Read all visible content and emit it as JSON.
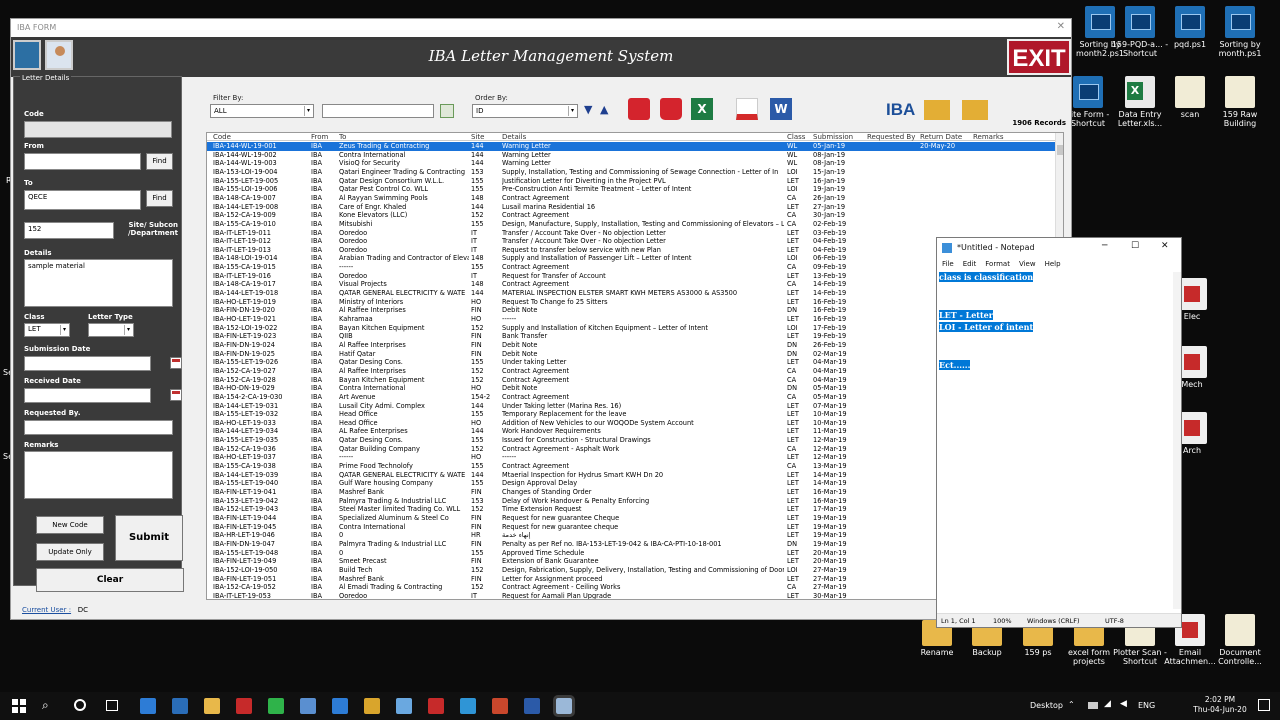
{
  "desktop": {
    "top_icons": [
      {
        "label": "Sorting by month2.ps1",
        "type": "ps"
      },
      {
        "label": "159-PQD-a... - Shortcut",
        "type": "ps"
      },
      {
        "label": "pqd.ps1",
        "type": "ps"
      },
      {
        "label": "Sorting by month.ps1",
        "type": "ps"
      }
    ],
    "mid_icons": [
      {
        "label": "site Form - Shortcut",
        "type": "ps"
      },
      {
        "label": "Data Entry Letter.xls...",
        "type": "xl"
      },
      {
        "label": "scan",
        "type": "doc"
      },
      {
        "label": "159 Raw Building",
        "type": "doc"
      }
    ],
    "side_icons": [
      {
        "label": "Elec",
        "type": "pdfic"
      },
      {
        "label": "Mech",
        "type": "pdfic"
      },
      {
        "label": "Arch",
        "type": "pdfic"
      }
    ],
    "bottom_icons": [
      {
        "label": "Rename",
        "type": "fold"
      },
      {
        "label": "Backup",
        "type": "fold"
      },
      {
        "label": "159 ps",
        "type": "fold"
      },
      {
        "label": "excel form projects",
        "type": "fold"
      },
      {
        "label": "Plotter Scan - Shortcut",
        "type": "doc"
      },
      {
        "label": "Email Attachmen...",
        "type": "pdfic"
      },
      {
        "label": "Document Controlle...",
        "type": "doc"
      }
    ],
    "left_edge_letters": [
      "R",
      "Se",
      "Se"
    ]
  },
  "app": {
    "window_title": "IBA FORM",
    "header_title": "IBA Letter Management System",
    "exit_label": "EXIT",
    "panel_title": "Letter Details",
    "labels": {
      "code": "Code",
      "from": "From",
      "to": "To",
      "site": "Site/ Subcon /Department",
      "details": "Details",
      "class": "Class",
      "letter_type": "Letter Type",
      "submission_date": "Submission Date",
      "received_date": "Received Date",
      "requested_by": "Requested By.",
      "remarks": "Remarks"
    },
    "values": {
      "code": "",
      "from": "",
      "to": "QECE",
      "site": "152",
      "details": "sample material",
      "class": "LET",
      "letter_type": "",
      "submission_date": "",
      "received_date": "",
      "requested_by": "",
      "remarks": ""
    },
    "buttons": {
      "find": "Find",
      "new_code": "New Code",
      "update_only": "Update Only",
      "submit": "Submit",
      "clear": "Clear"
    },
    "current_user_label": "Current User :",
    "current_user": "DC",
    "filter_by_label": "Filter By:",
    "filter_by_value": "ALL",
    "filter_text": "",
    "order_by_label": "Order By:",
    "order_by_value": "ID",
    "brand": "IBA",
    "records": "1906 Records",
    "columns": [
      "Code",
      "From",
      "To",
      "Site",
      "Details",
      "Class",
      "Submission",
      "Requested By",
      "Return Date",
      "Remarks"
    ],
    "rows": [
      [
        "IBA-144-WL-19-001",
        "IBA",
        "Zeus Trading & Contracting",
        "144",
        "Warning Letter",
        "WL",
        "05-Jan-19",
        "",
        "20-May-20",
        ""
      ],
      [
        "IBA-144-WL-19-002",
        "IBA",
        "Contra International",
        "144",
        "Warning Letter",
        "WL",
        "08-Jan-19",
        "",
        "",
        ""
      ],
      [
        "IBA-144-WL-19-003",
        "IBA",
        "VisioQ for Security",
        "144",
        "Warning Letter",
        "WL",
        "08-Jan-19",
        "",
        "",
        ""
      ],
      [
        "IBA-153-LOI-19-004",
        "IBA",
        "Qatari Engineer Trading & Contracting",
        "153",
        "Supply, Installation, Testing and Commissioning of Sewage Connection - Letter of In",
        "LOI",
        "15-Jan-19",
        "",
        "",
        ""
      ],
      [
        "IBA-155-LET-19-005",
        "IBA",
        "Qatar Design Consortium W.L.L.",
        "155",
        "Justification Letter for Diverting in the Project PVL",
        "LET",
        "16-Jan-19",
        "",
        "",
        ""
      ],
      [
        "IBA-155-LOI-19-006",
        "IBA",
        "Qatar Pest Control Co. WLL",
        "155",
        "Pre-Construction Anti Termite Treatment – Letter of Intent",
        "LOI",
        "19-Jan-19",
        "",
        "",
        ""
      ],
      [
        "IBA-148-CA-19-007",
        "IBA",
        "Al Rayyan Swimming Pools",
        "148",
        "Contract Agreement",
        "CA",
        "26-Jan-19",
        "",
        "",
        ""
      ],
      [
        "IBA-144-LET-19-008",
        "IBA",
        "Care  of Engr. Khaled",
        "144",
        "Lusail marina Residential 16",
        "LET",
        "27-Jan-19",
        "",
        "",
        ""
      ],
      [
        "IBA-152-CA-19-009",
        "IBA",
        "Kone Elevators (LLC)",
        "152",
        "Contract Agreement",
        "CA",
        "30-Jan-19",
        "",
        "",
        ""
      ],
      [
        "IBA-155-CA-19-010",
        "IBA",
        "Mitsubishi",
        "155",
        "Design, Manufacture, Supply, Installation, Testing and Commissioning of Elevators – Le",
        "CA",
        "02-Feb-19",
        "",
        "",
        ""
      ],
      [
        "IBA-IT-LET-19-011",
        "IBA",
        "Ooredoo",
        "IT",
        "Transfer / Account Take Over - No objection Letter",
        "LET",
        "03-Feb-19",
        "",
        "",
        ""
      ],
      [
        "IBA-IT-LET-19-012",
        "IBA",
        "Ooredoo",
        "IT",
        "Transfer / Account Take Over - No objection Letter",
        "LET",
        "04-Feb-19",
        "",
        "",
        ""
      ],
      [
        "IBA-IT-LET-19-013",
        "IBA",
        "Ooredoo",
        "IT",
        "Request to transfer below service with new Plan",
        "LET",
        "04-Feb-19",
        "",
        "",
        ""
      ],
      [
        "IBA-148-LOI-19-014",
        "IBA",
        "Arabian Trading and Contractor of Eleva",
        "148",
        "Supply and Installation of Passenger Lift – Letter of Intent",
        "LOI",
        "06-Feb-19",
        "",
        "",
        ""
      ],
      [
        "IBA-155-CA-19-015",
        "IBA",
        "------",
        "155",
        "Contract Agreement",
        "CA",
        "09-Feb-19",
        "",
        "",
        ""
      ],
      [
        "IBA-IT-LET-19-016",
        "IBA",
        "Ooredoo",
        "IT",
        "Request for  Transfer of Account",
        "LET",
        "13-Feb-19",
        "",
        "",
        ""
      ],
      [
        "IBA-148-CA-19-017",
        "IBA",
        "Visual Projects",
        "148",
        "Contract Agreement",
        "CA",
        "14-Feb-19",
        "",
        "",
        ""
      ],
      [
        "IBA-144-LET-19-018",
        "IBA",
        "QATAR GENERAL ELECTRICITY & WATE",
        "144",
        "MATERIAL INSPECTION ELSTER SMART KWH METERS AS3000 & AS3500",
        "LET",
        "14-Feb-19",
        "",
        "",
        ""
      ],
      [
        "IBA-HO-LET-19-019",
        "IBA",
        "Ministry of Interiors",
        "HO",
        "Request To Change fo 25 Sitters",
        "LET",
        "16-Feb-19",
        "",
        "",
        ""
      ],
      [
        "IBA-FIN-DN-19-020",
        "IBA",
        "Al Raffee Interprises",
        "FIN",
        "Debit Note",
        "DN",
        "16-Feb-19",
        "",
        "",
        ""
      ],
      [
        "IBA-HO-LET-19-021",
        "IBA",
        "Kahramaa",
        "HO",
        "------",
        "LET",
        "16-Feb-19",
        "",
        "",
        ""
      ],
      [
        "IBA-152-LOI-19-022",
        "IBA",
        "Bayan Kitchen Equipment",
        "152",
        "Supply and Installation of Kitchen Equipment – Letter of Intent",
        "LOI",
        "17-Feb-19",
        "",
        "",
        ""
      ],
      [
        "IBA-FIN-LET-19-023",
        "IBA",
        "QIIB",
        "FIN",
        "Bank Transfer",
        "LET",
        "19-Feb-19",
        "",
        "",
        ""
      ],
      [
        "IBA-FIN-DN-19-024",
        "IBA",
        "Al Raffee Interprises",
        "FIN",
        "Debit Note",
        "DN",
        "26-Feb-19",
        "",
        "",
        ""
      ],
      [
        "IBA-FIN-DN-19-025",
        "IBA",
        "Hatif Qatar",
        "FIN",
        "Debit Note",
        "DN",
        "02-Mar-19",
        "",
        "",
        ""
      ],
      [
        "IBA-155-LET-19-026",
        "IBA",
        "Qatar Desing Cons.",
        "155",
        "Under taking Letter",
        "LET",
        "04-Mar-19",
        "",
        "",
        ""
      ],
      [
        "IBA-152-CA-19-027",
        "IBA",
        "Al Raffee Interprises",
        "152",
        "Contract Agreement",
        "CA",
        "04-Mar-19",
        "",
        "",
        ""
      ],
      [
        "IBA-152-CA-19-028",
        "IBA",
        "Bayan Kitchen Equipment",
        "152",
        "Contract Agreement",
        "CA",
        "04-Mar-19",
        "",
        "",
        ""
      ],
      [
        "IBA-HO-DN-19-029",
        "IBA",
        "Contra International",
        "HO",
        "Debit Note",
        "DN",
        "05-Mar-19",
        "",
        "",
        ""
      ],
      [
        "IBA-154-2-CA-19-030",
        "IBA",
        "Art Avenue",
        "154-2",
        "Contract Agreement",
        "CA",
        "05-Mar-19",
        "",
        "",
        ""
      ],
      [
        "IBA-144-LET-19-031",
        "IBA",
        "Lusail City Admi. Complex",
        "144",
        "Under Taking letter (Marina Res. 16)",
        "LET",
        "07-Mar-19",
        "",
        "",
        ""
      ],
      [
        "IBA-155-LET-19-032",
        "IBA",
        "Head Office",
        "155",
        "Temporary Replacement for the leave",
        "LET",
        "10-Mar-19",
        "",
        "",
        ""
      ],
      [
        "IBA-HO-LET-19-033",
        "IBA",
        "Head Office",
        "HO",
        "Addition of New Vehicles to our WOQODe System Account",
        "LET",
        "10-Mar-19",
        "",
        "",
        ""
      ],
      [
        "IBA-144-LET-19-034",
        "IBA",
        "AL Rafee Enterprises",
        "144",
        "Work Handover Requirements",
        "LET",
        "11-Mar-19",
        "",
        "",
        ""
      ],
      [
        "IBA-155-LET-19-035",
        "IBA",
        "Qatar Desing Cons.",
        "155",
        "Issued for Construction - Structural Drawings",
        "LET",
        "12-Mar-19",
        "",
        "",
        ""
      ],
      [
        "IBA-152-CA-19-036",
        "IBA",
        "Qatar Building Company",
        "152",
        "Contract Agreement - Asphalt Work",
        "CA",
        "12-Mar-19",
        "",
        "",
        ""
      ],
      [
        "IBA-HO-LET-19-037",
        "IBA",
        "------",
        "HO",
        "------",
        "LET",
        "12-Mar-19",
        "",
        "",
        ""
      ],
      [
        "IBA-155-CA-19-038",
        "IBA",
        "Prime Food Technolofy",
        "155",
        "Contract Agreement",
        "CA",
        "13-Mar-19",
        "",
        "",
        ""
      ],
      [
        "IBA-144-LET-19-039",
        "IBA",
        "QATAR GENERAL ELECTRICITY & WATE",
        "144",
        "Mtaerial Inspection for Hydrus Smart KWH Dn 20",
        "LET",
        "14-Mar-19",
        "",
        "",
        ""
      ],
      [
        "IBA-155-LET-19-040",
        "IBA",
        "Gulf Ware housing Company",
        "155",
        "Design Approval Delay",
        "LET",
        "14-Mar-19",
        "",
        "",
        ""
      ],
      [
        "IBA-FIN-LET-19-041",
        "IBA",
        "Mashref Bank",
        "FIN",
        "Changes of Standing Order",
        "LET",
        "16-Mar-19",
        "",
        "",
        ""
      ],
      [
        "IBA-153-LET-19-042",
        "IBA",
        "Palmyra Trading & Industrial LLC",
        "153",
        "Delay of Work Handover & Penalty Enforcing",
        "LET",
        "16-Mar-19",
        "",
        "",
        ""
      ],
      [
        "IBA-152-LET-19-043",
        "IBA",
        "Steel Master limited Trading Co. WLL",
        "152",
        "Time Extension Request",
        "LET",
        "17-Mar-19",
        "",
        "",
        ""
      ],
      [
        "IBA-FIN-LET-19-044",
        "IBA",
        "Specialized Aluminum & Steel Co",
        "FIN",
        "Request for new guarantee Cheque",
        "LET",
        "19-Mar-19",
        "",
        "",
        ""
      ],
      [
        "IBA-FIN-LET-19-045",
        "IBA",
        "Contra International",
        "FIN",
        "Request for new guarantee cheque",
        "LET",
        "19-Mar-19",
        "",
        "",
        ""
      ],
      [
        "IBA-HR-LET-19-046",
        "IBA",
        "0",
        "HR",
        "إنهاء خدمة",
        "LET",
        "19-Mar-19",
        "",
        "",
        ""
      ],
      [
        "IBA-FIN-DN-19-047",
        "IBA",
        "Palmyra Trading & Industrial LLC",
        "FIN",
        "Penalty as per Ref no. IBA-153-LET-19-042 & IBA-CA-PTI-10-18-001",
        "DN",
        "19-Mar-19",
        "",
        "",
        ""
      ],
      [
        "IBA-155-LET-19-048",
        "IBA",
        "0",
        "155",
        "Approved Time Schedule",
        "LET",
        "20-Mar-19",
        "",
        "",
        ""
      ],
      [
        "IBA-FIN-LET-19-049",
        "IBA",
        "Smeet Precast",
        "FIN",
        "Extension of Bank Guarantee",
        "LET",
        "20-Mar-19",
        "",
        "",
        ""
      ],
      [
        "IBA-152-LOI-19-050",
        "IBA",
        "Build Tech",
        "152",
        "Design, Fabrication, Supply, Delivery, Installation, Testing and Commissioning of Doors",
        "LOI",
        "27-Mar-19",
        "",
        "",
        ""
      ],
      [
        "IBA-FIN-LET-19-051",
        "IBA",
        "Mashref Bank",
        "FIN",
        "Letter for Assignment proceed",
        "LET",
        "27-Mar-19",
        "",
        "",
        ""
      ],
      [
        "IBA-152-CA-19-052",
        "IBA",
        "Al Emadi Trading & Contracting",
        "152",
        "Contract Agreement  - Ceiling Works",
        "CA",
        "27-Mar-19",
        "",
        "",
        ""
      ],
      [
        "IBA-IT-LET-19-053",
        "IBA",
        "Ooredoo",
        "IT",
        "Request for Aamali Plan Upgrade",
        "LET",
        "30-Mar-19",
        "",
        "",
        ""
      ]
    ]
  },
  "notepad": {
    "title": "*Untitled - Notepad",
    "menu": [
      "File",
      "Edit",
      "Format",
      "View",
      "Help"
    ],
    "lines": [
      "class is classification",
      "",
      "",
      "LET - Letter",
      "LOI - Letter of intent",
      "",
      "",
      "Ect......"
    ],
    "status": {
      "pos": "Ln 1, Col 1",
      "zoom": "100%",
      "eol": "Windows (CRLF)",
      "enc": "UTF-8"
    }
  },
  "taskbar": {
    "search_placeholder": "",
    "desktop_label": "Desktop",
    "lang": "ENG",
    "time": "2:02 PM",
    "date": "Thu-04-Jun-20",
    "apps": [
      "edge-icon",
      "outlook-icon",
      "explorer-icon",
      "acrobat-icon",
      "whatsapp-icon",
      "settings-icon",
      "mail-icon",
      "chrome-icon",
      "app-icon",
      "pdf-icon",
      "teams-icon",
      "powerpoint-icon",
      "word-icon",
      "iba-form-icon"
    ]
  }
}
